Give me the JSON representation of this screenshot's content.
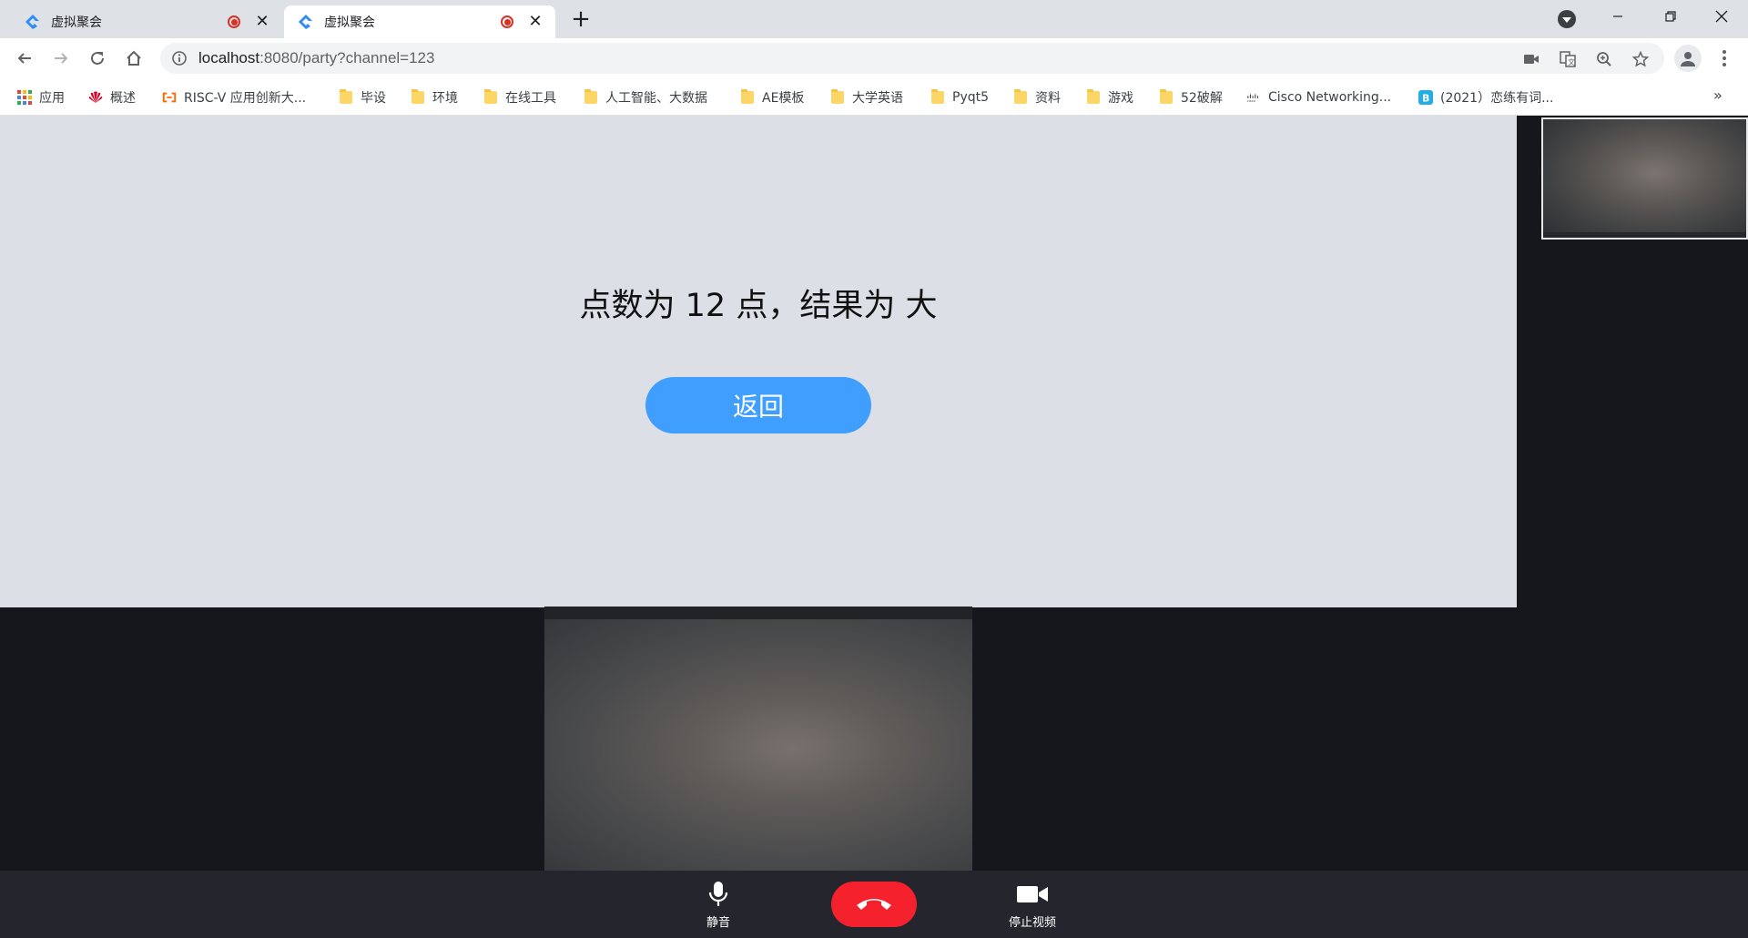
{
  "browser": {
    "tabs": [
      {
        "title": "虚拟聚会",
        "active": false,
        "recording": true
      },
      {
        "title": "虚拟聚会",
        "active": true,
        "recording": true
      }
    ],
    "url_host": "localhost",
    "url_rest": ":8080/party?channel=123",
    "bookmarks": [
      {
        "label": "应用",
        "icon": "apps-grid-icon"
      },
      {
        "label": "概述",
        "icon": "huawei-icon"
      },
      {
        "label": "RISC-V 应用创新大...",
        "icon": "aliyun-icon"
      },
      {
        "label": "毕设",
        "icon": "folder-icon"
      },
      {
        "label": "环境",
        "icon": "folder-icon"
      },
      {
        "label": "在线工具",
        "icon": "folder-icon"
      },
      {
        "label": "人工智能、大数据",
        "icon": "folder-icon"
      },
      {
        "label": "AE模板",
        "icon": "folder-icon"
      },
      {
        "label": "大学英语",
        "icon": "folder-icon"
      },
      {
        "label": "Pyqt5",
        "icon": "folder-icon"
      },
      {
        "label": "资料",
        "icon": "folder-icon"
      },
      {
        "label": "游戏",
        "icon": "folder-icon"
      },
      {
        "label": "52破解",
        "icon": "folder-icon"
      },
      {
        "label": "Cisco Networking...",
        "icon": "cisco-icon"
      },
      {
        "label": "(2021）恋练有词...",
        "icon": "bilibili-icon"
      }
    ],
    "bookmarks_more": "»"
  },
  "game": {
    "result_text": "点数为 12 点，结果为 大",
    "back_label": "返回"
  },
  "controls": {
    "mute_label": "静音",
    "stop_video_label": "停止视频"
  },
  "colors": {
    "accent": "#409eff",
    "hangup": "#f5222d",
    "panel_bg": "#dcdfe6",
    "stage_bg": "#16171d"
  }
}
